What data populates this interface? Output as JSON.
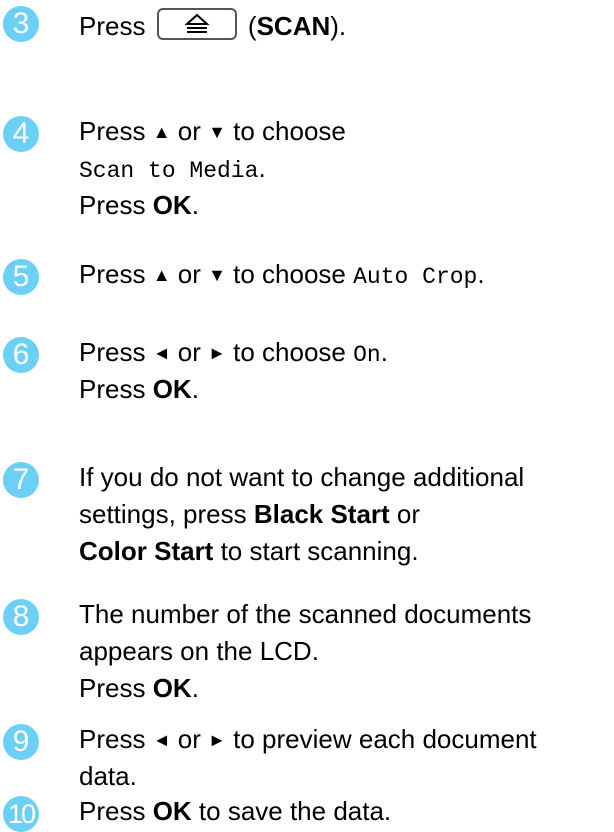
{
  "steps": [
    {
      "num": "3",
      "lines": [
        [
          "Press ",
          {
            "btn": "scan-icon"
          },
          " (",
          {
            "b": "SCAN"
          },
          ")."
        ]
      ]
    },
    {
      "num": "4",
      "lines": [
        [
          "Press ",
          {
            "a": "▲"
          },
          " or ",
          {
            "a": "▼"
          },
          " to choose"
        ],
        [
          {
            "m": "Scan to Media"
          },
          "."
        ],
        [
          "Press ",
          {
            "b": "OK"
          },
          "."
        ]
      ]
    },
    {
      "num": "5",
      "lines": [
        [
          "Press ",
          {
            "a": "▲"
          },
          " or ",
          {
            "a": "▼"
          },
          " to choose ",
          {
            "m": "Auto Crop"
          },
          "."
        ]
      ]
    },
    {
      "num": "6",
      "lines": [
        [
          "Press ",
          {
            "a": "◄"
          },
          " or ",
          {
            "a": "►"
          },
          " to choose ",
          {
            "m": "On"
          },
          "."
        ],
        [
          "Press ",
          {
            "b": "OK"
          },
          "."
        ]
      ]
    },
    {
      "num": "7",
      "lines": [
        [
          "If you do not want to change additional"
        ],
        [
          "settings, press ",
          {
            "b": "Black Start"
          },
          " or"
        ],
        [
          {
            "b": "Color Start"
          },
          " to start scanning."
        ]
      ]
    },
    {
      "num": "8",
      "lines": [
        [
          "The number of the scanned documents"
        ],
        [
          "appears on the LCD."
        ],
        [
          "Press ",
          {
            "b": "OK"
          },
          "."
        ]
      ]
    },
    {
      "num": "9",
      "lines": [
        [
          "Press ",
          {
            "a": "◄"
          },
          " or ",
          {
            "a": "►"
          },
          " to preview each document"
        ],
        [
          "data."
        ]
      ]
    },
    {
      "num": "10",
      "lines": [
        [
          "Press ",
          {
            "b": "OK"
          },
          " to save the data."
        ]
      ]
    }
  ]
}
